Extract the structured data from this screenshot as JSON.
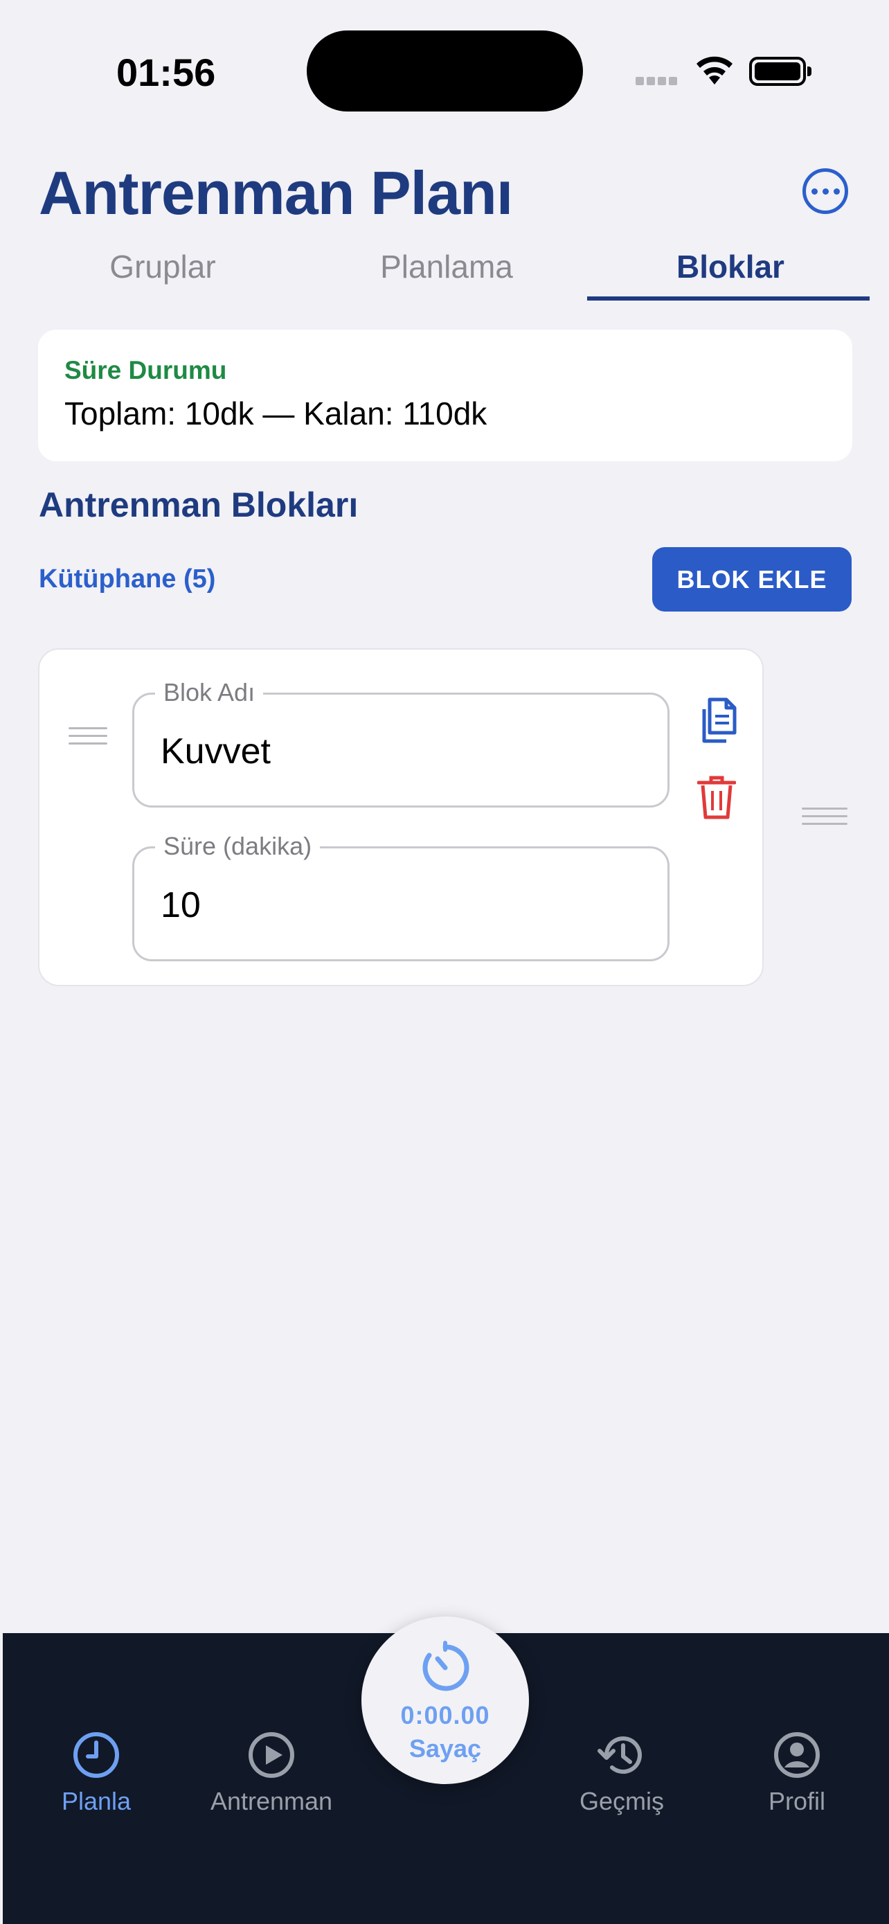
{
  "status_bar": {
    "time": "01:56"
  },
  "header": {
    "title": "Antrenman Planı"
  },
  "tabs": [
    {
      "label": "Gruplar",
      "active": false
    },
    {
      "label": "Planlama",
      "active": false
    },
    {
      "label": "Bloklar",
      "active": true
    }
  ],
  "summary": {
    "label": "Süre Durumu",
    "value": "Toplam: 10dk — Kalan: 110dk"
  },
  "blocks_section": {
    "title": "Antrenman Blokları",
    "library_link": "Kütüphane (5)",
    "add_button": "BLOK EKLE"
  },
  "block": {
    "name_label": "Blok Adı",
    "name_value": "Kuvvet",
    "duration_label": "Süre (dakika)",
    "duration_value": "10"
  },
  "bottom_nav": {
    "items": [
      {
        "label": "Planla",
        "icon": "clock-icon",
        "active": true
      },
      {
        "label": "Antrenman",
        "icon": "play-circle-icon",
        "active": false
      },
      {
        "label": "Geçmiş",
        "icon": "history-icon",
        "active": false
      },
      {
        "label": "Profil",
        "icon": "profile-icon",
        "active": false
      }
    ],
    "timer": {
      "time": "0:00.00",
      "label": "Sayaç",
      "icon": "timer-icon"
    }
  },
  "colors": {
    "primary": "#1f3b80",
    "accent": "#2b5bc6",
    "success": "#1f8a44",
    "danger": "#e03a3a",
    "nav_bg": "#111827",
    "nav_active": "#6ea0f2"
  }
}
